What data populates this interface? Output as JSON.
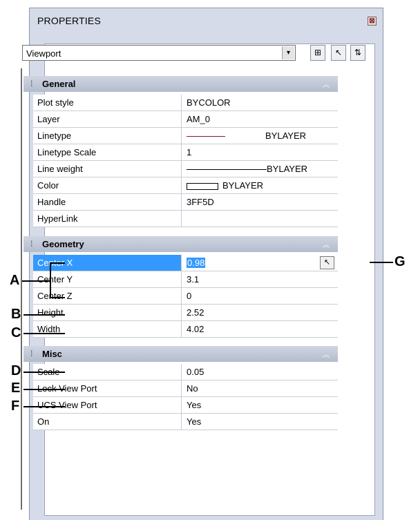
{
  "palette": {
    "title": "PROPERTIES",
    "close_glyph": "⊠",
    "object_select": {
      "value": "Viewport",
      "arrow": "▾"
    },
    "toolbar": [
      {
        "name": "quick-select-icon",
        "glyph": "⊞"
      },
      {
        "name": "select-objects-icon",
        "glyph": "↖"
      },
      {
        "name": "pickadd-toggle-icon",
        "glyph": "⇅"
      }
    ]
  },
  "sections": {
    "general": {
      "title": "General",
      "rows": [
        {
          "name": "Plot style",
          "value": "BYCOLOR"
        },
        {
          "name": "Layer",
          "value": "AM_0"
        },
        {
          "name": "Linetype",
          "value": "BYLAYER"
        },
        {
          "name": "Linetype Scale",
          "value": "1"
        },
        {
          "name": "Line weight",
          "value": "BYLAYER"
        },
        {
          "name": "Color",
          "value": "BYLAYER"
        },
        {
          "name": "Handle",
          "value": "3FF5D"
        },
        {
          "name": "HyperLink",
          "value": ""
        }
      ]
    },
    "geometry": {
      "title": "Geometry",
      "rows": [
        {
          "name": "Center X",
          "value": "0.98"
        },
        {
          "name": "Center Y",
          "value": "3.1"
        },
        {
          "name": "Center Z",
          "value": "0"
        },
        {
          "name": "Height",
          "value": "2.52"
        },
        {
          "name": "Width",
          "value": "4.02"
        }
      ]
    },
    "misc": {
      "title": "Misc",
      "rows": [
        {
          "name": "Scale",
          "value": "0.05"
        },
        {
          "name": "Lock View Port",
          "value": "No"
        },
        {
          "name": "UCS View Port",
          "value": "Yes"
        },
        {
          "name": "On",
          "value": "Yes"
        }
      ]
    }
  },
  "callouts": {
    "a": "A",
    "b": "B",
    "c": "C",
    "d": "D",
    "e": "E",
    "f": "F",
    "g": "G"
  },
  "colors": {
    "selection": "#3399ff",
    "linetype_sample": "#7a1c2e",
    "header": "#b4bccc"
  }
}
